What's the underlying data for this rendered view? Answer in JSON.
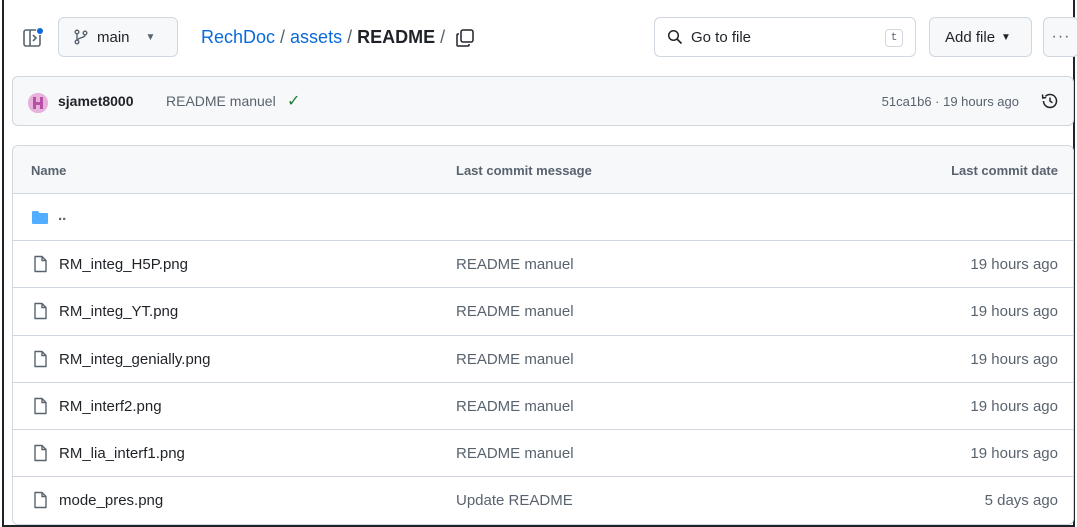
{
  "header": {
    "branch": "main",
    "breadcrumb": {
      "repo": "RechDoc",
      "folder": "assets",
      "current": "README",
      "separator": "/"
    },
    "search_placeholder": "Go to file",
    "search_shortcut": "t",
    "add_file_label": "Add file",
    "more_label": "···"
  },
  "commit": {
    "author": "sjamet8000",
    "message": "README manuel",
    "status": "✓",
    "sha_time": "51ca1b6 · 19 hours ago"
  },
  "table": {
    "columns": [
      "Name",
      "Last commit message",
      "Last commit date"
    ],
    "parent_label": "..",
    "rows": [
      {
        "name": "RM_integ_H5P.png",
        "message": "README manuel",
        "date": "19 hours ago"
      },
      {
        "name": "RM_integ_YT.png",
        "message": "README manuel",
        "date": "19 hours ago"
      },
      {
        "name": "RM_integ_genially.png",
        "message": "README manuel",
        "date": "19 hours ago"
      },
      {
        "name": "RM_interf2.png",
        "message": "README manuel",
        "date": "19 hours ago"
      },
      {
        "name": "RM_lia_interf1.png",
        "message": "README manuel",
        "date": "19 hours ago"
      },
      {
        "name": "mode_pres.png",
        "message": "Update README",
        "date": "5 days ago"
      }
    ]
  },
  "colors": {
    "link": "#0969da",
    "muted": "#59636e",
    "border": "#d0d7de",
    "folder": "#54aeff",
    "success": "#1a7f37"
  }
}
